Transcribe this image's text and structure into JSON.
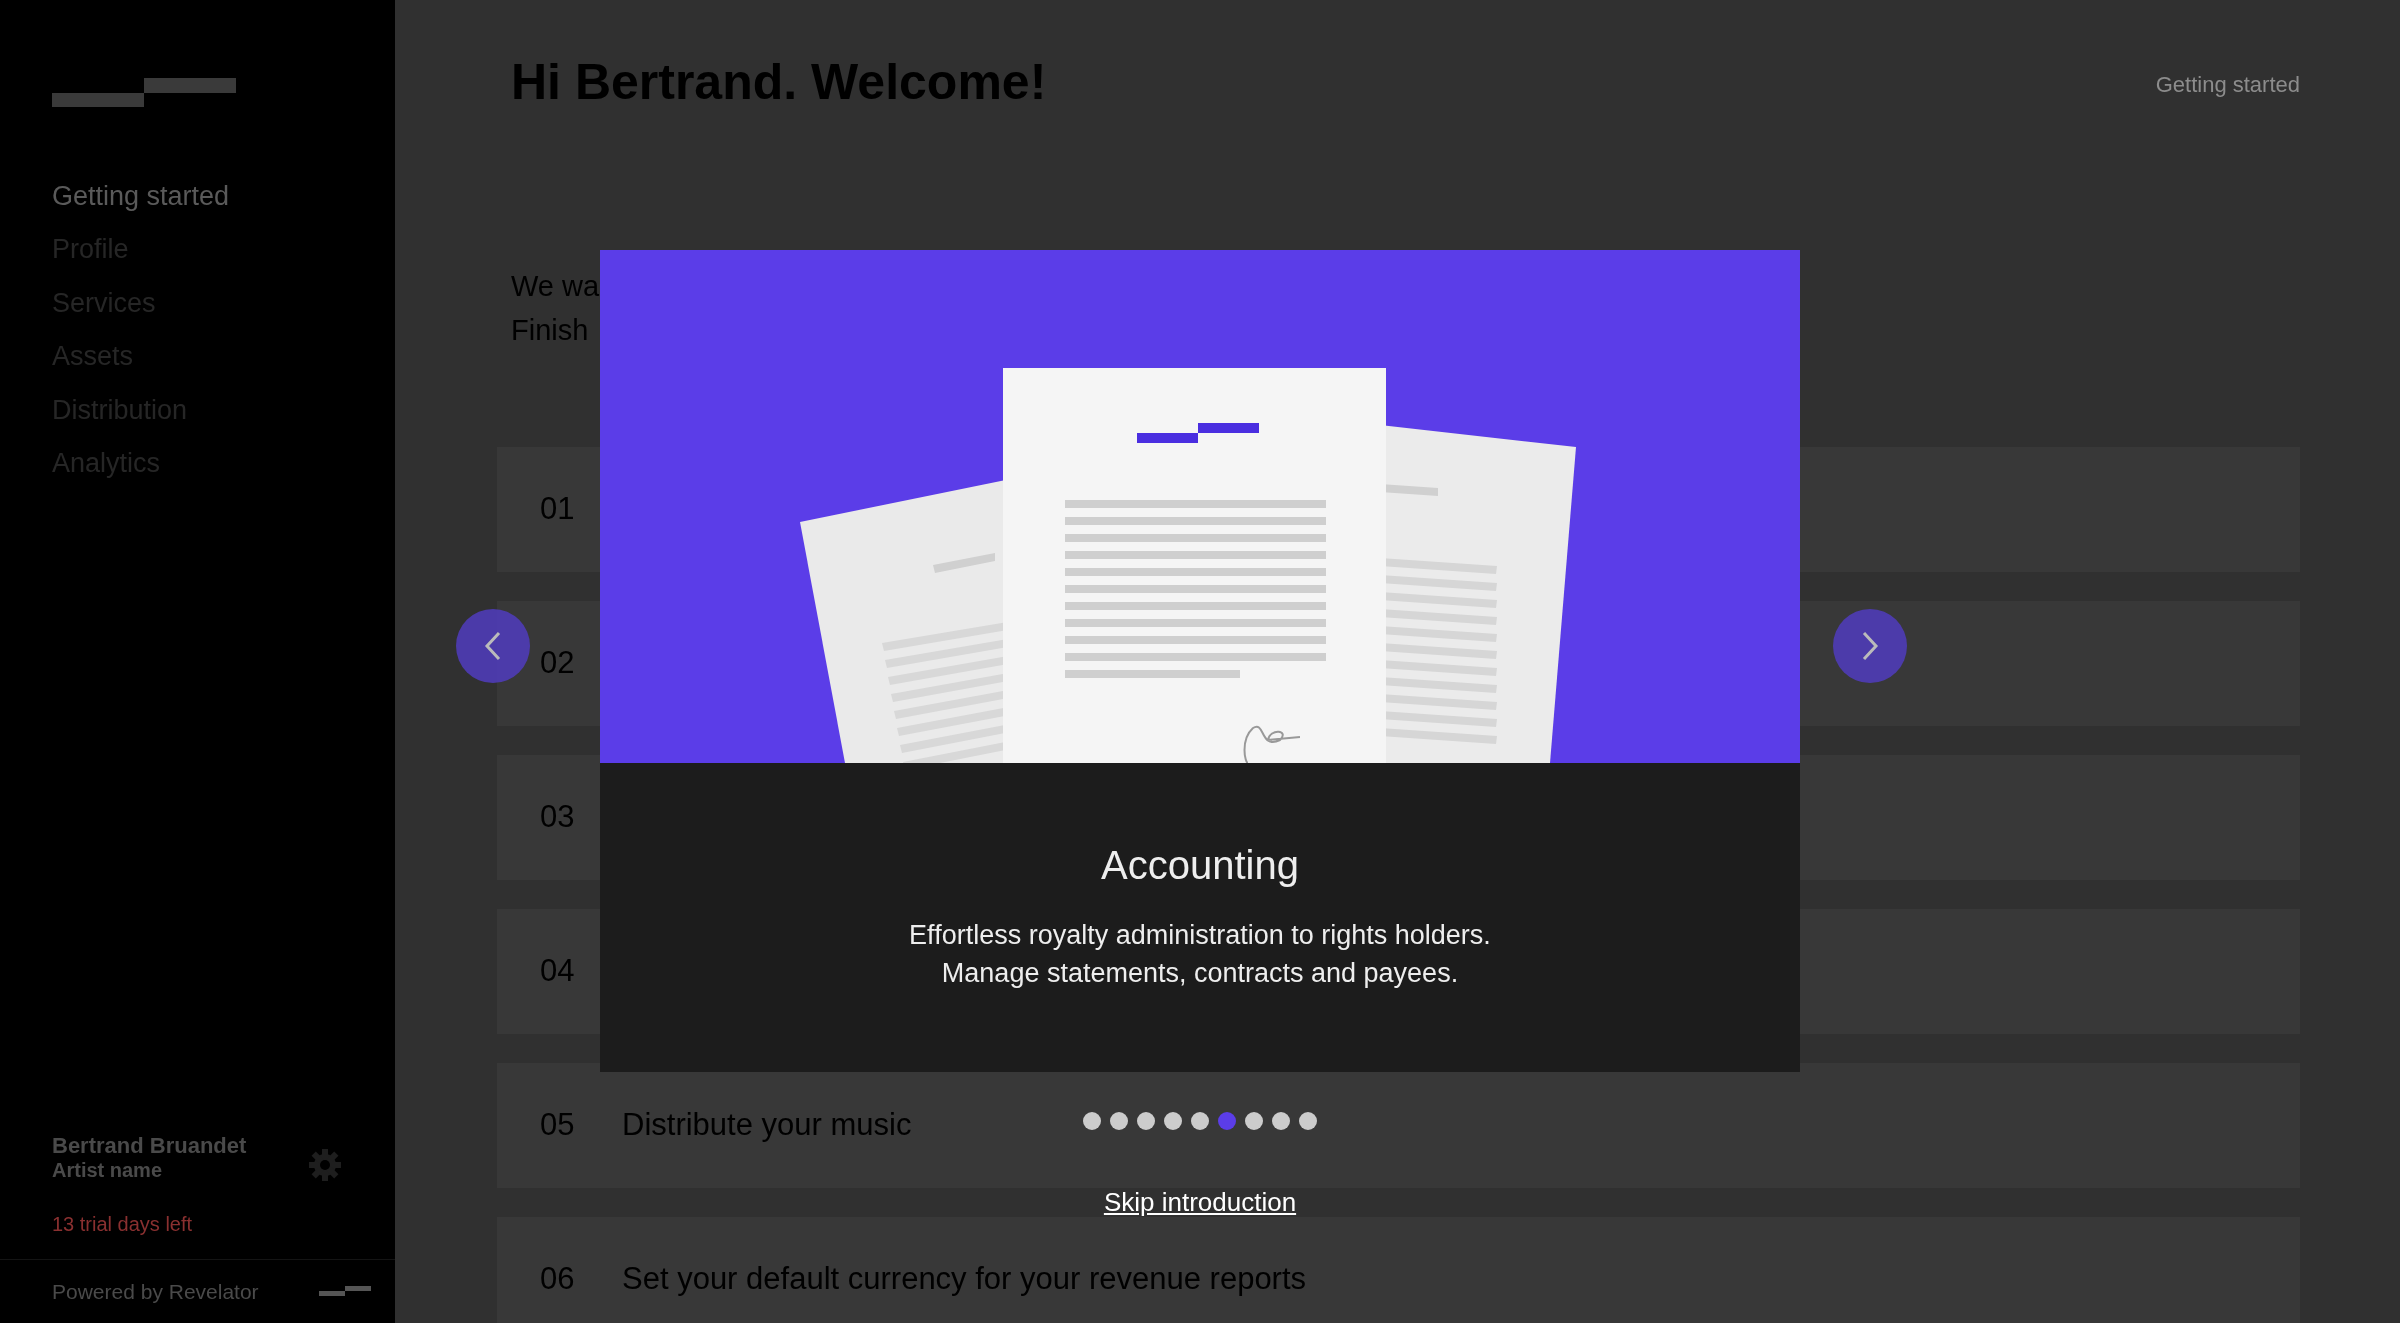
{
  "sidebar": {
    "nav": [
      {
        "label": "Getting started",
        "selected": true
      },
      {
        "label": "Profile",
        "selected": false
      },
      {
        "label": "Services",
        "selected": false
      },
      {
        "label": "Assets",
        "selected": false
      },
      {
        "label": "Distribution",
        "selected": false
      },
      {
        "label": "Analytics",
        "selected": false
      }
    ],
    "user": {
      "name": "Bertrand Bruandet",
      "role": "Artist name"
    },
    "trial": "13 trial days left",
    "powered_by": "Powered by Revelator"
  },
  "header": {
    "title": "Hi Bertrand. Welcome!",
    "breadcrumb": "Getting started"
  },
  "intro": [
    "We wa",
    "Finish"
  ],
  "steps": [
    {
      "number": "01"
    },
    {
      "number": "02"
    },
    {
      "number": "03"
    },
    {
      "number": "04"
    },
    {
      "number": "05",
      "label": "Distribute your music"
    },
    {
      "number": "06",
      "label": "Set your default currency for your revenue reports"
    }
  ],
  "modal": {
    "title": "Accounting",
    "description": [
      "Effortless royalty administration to rights holders.",
      "Manage statements, contracts and payees."
    ],
    "dots": [
      {
        "selected": false
      },
      {
        "selected": false
      },
      {
        "selected": false
      },
      {
        "selected": false
      },
      {
        "selected": false
      },
      {
        "selected": true
      },
      {
        "selected": false
      },
      {
        "selected": false
      },
      {
        "selected": false
      }
    ],
    "skip": "Skip introduction"
  }
}
